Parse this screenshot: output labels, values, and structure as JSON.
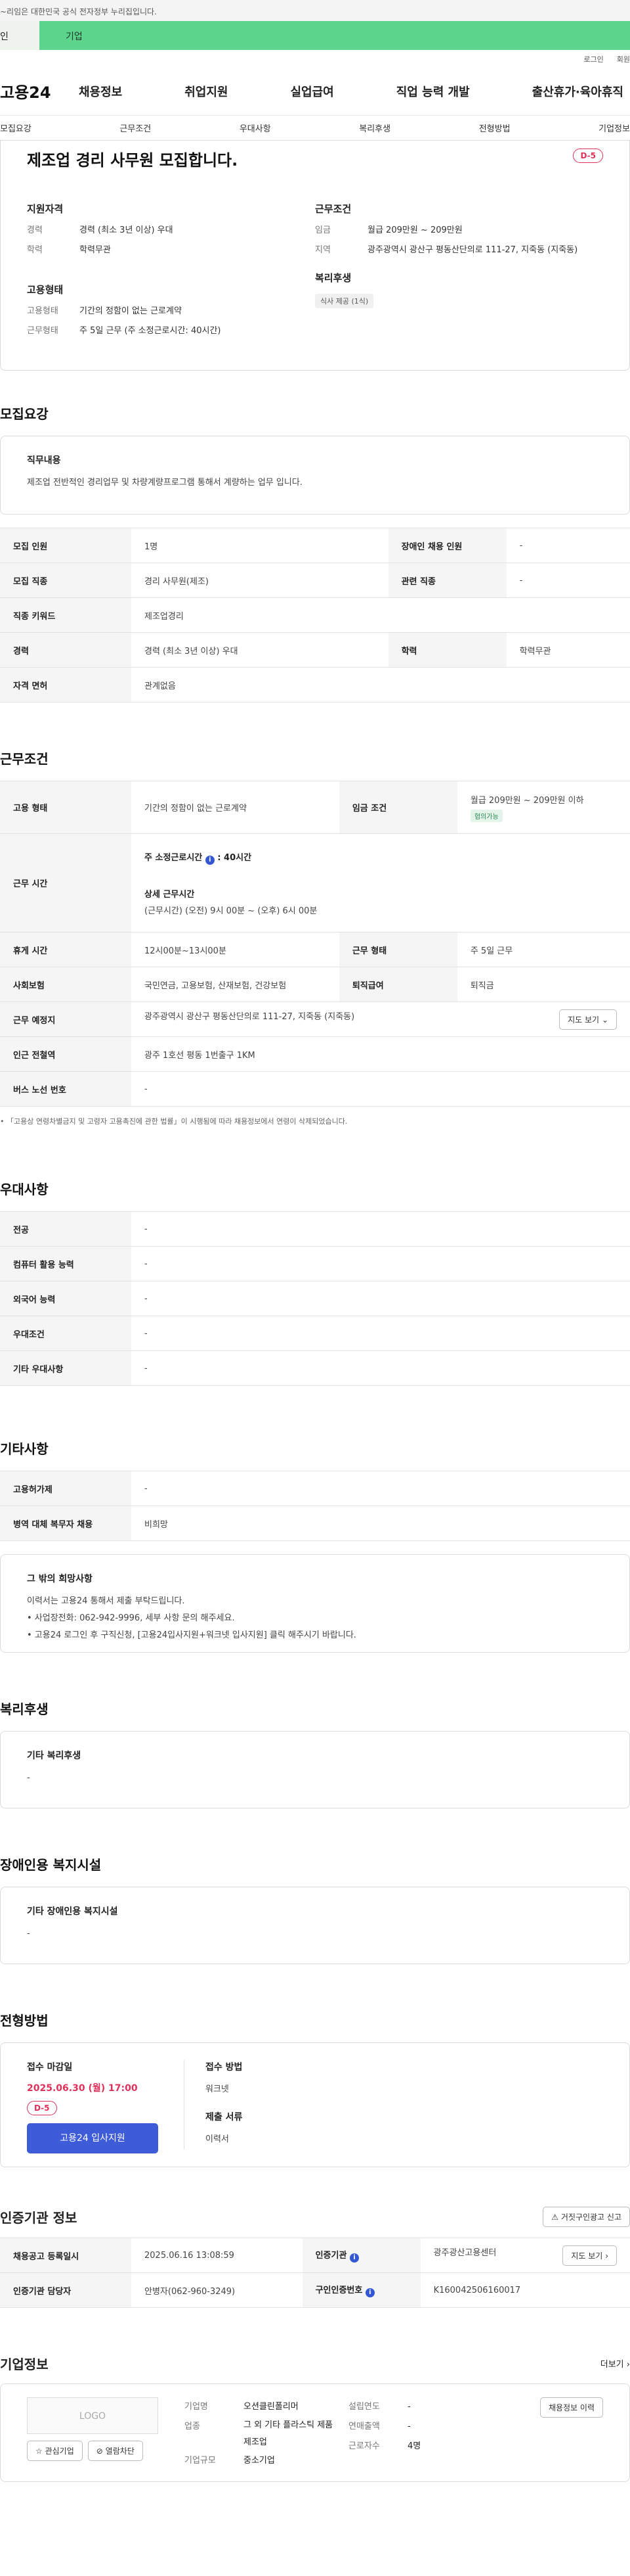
{
  "notice": "~리임은 대한민국 공식 전자정부 누리집입니다.",
  "site_tabs": {
    "a": "인",
    "b": "기업"
  },
  "util": {
    "login": "로그인",
    "signup": "회원"
  },
  "logo": "고용24",
  "gnb": [
    "채용정보",
    "취업지원",
    "실업급여",
    "직업 능력 개발",
    "출산휴가·육아휴직"
  ],
  "anchor": [
    "모집요강",
    "근무조건",
    "우대사항",
    "복리후생",
    "전형방법",
    "기업정보"
  ],
  "job": {
    "title": "제조업 경리 사무원 모집합니다.",
    "dday": "D-5"
  },
  "summary": {
    "qual_h": "지원자격",
    "career_k": "경력",
    "career_v": "경력 (최소 3년 이상) 우대",
    "edu_k": "학력",
    "edu_v": "학력무관",
    "cond_h": "근무조건",
    "wage_k": "임금",
    "wage_v": "월급 209만원 ~ 209만원",
    "area_k": "지역",
    "area_v": "광주광역시 광산구 평동산단의로 111-27, 지죽동 (지죽동)",
    "emp_h": "고용형태",
    "type_k": "고용형태",
    "type_v": "기간의 정함이 없는 근로계약",
    "hours_k": "근무형태",
    "hours_v": "주 5일 근무 (주 소정근로시간: 40시간)",
    "welf_h": "복리후생",
    "welf_v": "식사 제공 (1식)"
  },
  "s1": {
    "title": "모집요강",
    "duty_h": "직무내용",
    "duty_v": "제조업 전반적인 경리업무 및 차량계량프로그램 통해서 계량하는 업무 입니다.",
    "r1k": "모집 인원",
    "r1v": "1명",
    "r1k2": "장애인 채용 인원",
    "r1v2": "-",
    "r2k": "모집 직종",
    "r2v": "경리 사무원(제조)",
    "r2k2": "관련 직종",
    "r2v2": "-",
    "r3k": "직종 키워드",
    "r3v": "제조업경리",
    "r4k": "경력",
    "r4v": "경력 (최소 3년 이상) 우대",
    "r4k2": "학력",
    "r4v2": "학력무관",
    "r5k": "자격 면허",
    "r5v": "관계없음"
  },
  "s2": {
    "title": "근무조건",
    "a1k": "고용 형태",
    "a1v": "기간의 정함이 없는 근로계약",
    "a1k2": "임금 조건",
    "a1v2": "월급 209만원 ~ 209만원 이하",
    "a1tag": "협의가능",
    "a2k": "근무 시간",
    "a2v1": "주 소정근로시간",
    "a2v1b": ": 40시간",
    "a2v2": "상세 근무시간",
    "a2v3": "(근무시간) (오전) 9시 00분 ~ (오후) 6시 00분",
    "a3k": "휴게 시간",
    "a3v": "12시00분~13시00분",
    "a3k2": "근무 형태",
    "a3v2": "주 5일 근무",
    "a4k": "사회보험",
    "a4v": "국민연금, 고용보험, 산재보험, 건강보험",
    "a4k2": "퇴직급여",
    "a4v2": "퇴직금",
    "a5k": "근무 예정지",
    "a5v": "광주광역시 광산구 평동산단의로 111-27, 지죽동 (지죽동)",
    "a5btn": "지도 보기",
    "a6k": "인근 전철역",
    "a6v": "광주 1호선 평동 1번출구 1KM",
    "a7k": "버스 노선 번호",
    "a7v": "-",
    "note": "「고용상 연령차별금지 및 고령자 고용촉진에 관한 법률」이 시행됨에 따라 채용정보에서 연령이 삭제되었습니다."
  },
  "s3": {
    "title": "우대사항",
    "rows": [
      [
        "전공",
        "-"
      ],
      [
        "컴퓨터 활용 능력",
        "-"
      ],
      [
        "외국어 능력",
        "-"
      ],
      [
        "우대조건",
        "-"
      ],
      [
        "기타 우대사항",
        "-"
      ]
    ]
  },
  "s4": {
    "title": "기타사항",
    "rows": [
      [
        "고용허가제",
        "-"
      ],
      [
        "병역 대체 복무자 채용",
        "비희망"
      ]
    ],
    "hope_h": "그 밖의 희망사항",
    "hope_1": "이력서는 고용24 통해서 제출 부탁드립니다.",
    "hope_2": "• 사업장전화: 062-942-9996, 세부 사항 문의 해주세요.",
    "hope_3": "• 고용24 로그인 후 구직신청, [고용24입사지원+워크넷 입사지원] 클릭 해주시기 바랍니다."
  },
  "s5": {
    "title": "복리후생",
    "h": "기타 복리후생",
    "v": "-"
  },
  "s6": {
    "title": "장애인용 복지시설",
    "h": "기타 장애인용 복지시설",
    "v": "-"
  },
  "s7": {
    "title": "전형방법",
    "deadline_h": "접수 마감일",
    "deadline_v": "2025.06.30 (월) 17:00",
    "dday": "D-5",
    "apply": "고용24 입사지원",
    "method_h": "접수 방법",
    "method_v": "워크넷",
    "doc_h": "제출 서류",
    "doc_v": "이력서"
  },
  "s8": {
    "title": "인증기관 정보",
    "report": "거짓구인광고 신고",
    "b1k": "채용공고 등록일시",
    "b1v": "2025.06.16 13:08:59",
    "b1k2": "인증기관",
    "b1v2": "광주광산고용센터",
    "b1btn": "지도 보기",
    "b2k": "인증기관 담당자",
    "b2v": "안병자(062-960-3249)",
    "b2k2": "구인인증번호",
    "b2v2": "K160042506160017"
  },
  "s9": {
    "title": "기업정보",
    "more": "더보기",
    "logo": "LOGO",
    "fav": "관심기업",
    "block": "열람차단",
    "c1k": "기업명",
    "c1v": "오션클린폴리머",
    "c2k": "업종",
    "c2v": "그 외 기타 플라스틱 제품 제조업",
    "c3k": "기업규모",
    "c3v": "중소기업",
    "d1k": "설립연도",
    "d1v": "-",
    "d2k": "연매출액",
    "d2v": "-",
    "d3k": "근로자수",
    "d3v": "4명",
    "btn": "채용정보 이력"
  },
  "colors": {
    "green": "#5cd48c",
    "red": "#e0315b",
    "blue": "#3e5bd8"
  }
}
